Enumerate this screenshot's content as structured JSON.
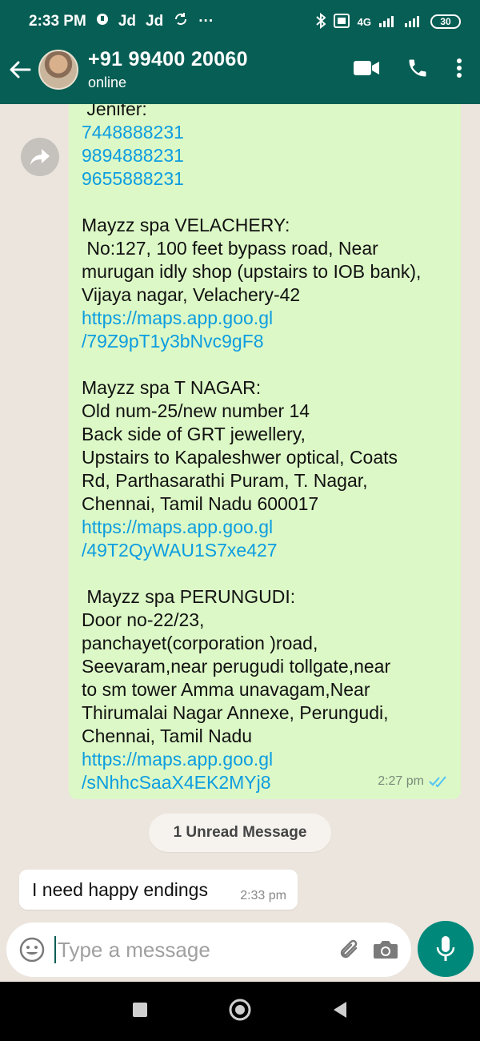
{
  "status_bar": {
    "time": "2:33 PM",
    "carrier_1": "Jd",
    "carrier_2": "Jd",
    "more": "···",
    "network": "4G",
    "battery": "30"
  },
  "header": {
    "contact_name": "+91 99400 20060",
    "contact_status": "online"
  },
  "chat": {
    "outgoing": {
      "lines": [
        {
          "text": " Jenifer:",
          "type": "text"
        },
        {
          "text": "7448888231",
          "type": "link"
        },
        {
          "text": "9894888231",
          "type": "link"
        },
        {
          "text": "9655888231",
          "type": "link"
        },
        {
          "text": "",
          "type": "gap"
        },
        {
          "text": "Mayzz spa VELACHERY:",
          "type": "text"
        },
        {
          "text": " No:127, 100 feet bypass road, Near",
          "type": "text"
        },
        {
          "text": "murugan idly shop (upstairs to IOB bank),",
          "type": "text"
        },
        {
          "text": "Vijaya nagar, Velachery-42",
          "type": "text"
        },
        {
          "text": "https://maps.app.goo.gl",
          "type": "link"
        },
        {
          "text": "/79Z9pT1y3bNvc9gF8",
          "type": "link"
        },
        {
          "text": "",
          "type": "gap"
        },
        {
          "text": "Mayzz spa T NAGAR:",
          "type": "text"
        },
        {
          "text": "Old num-25/new number 14",
          "type": "text"
        },
        {
          "text": "Back side of GRT jewellery,",
          "type": "text"
        },
        {
          "text": "Upstairs to Kapaleshwer optical, Coats",
          "type": "text"
        },
        {
          "text": "Rd, Parthasarathi Puram, T. Nagar,",
          "type": "text"
        },
        {
          "text": "Chennai, Tamil Nadu 600017",
          "type": "text"
        },
        {
          "text": "https://maps.app.goo.gl",
          "type": "link"
        },
        {
          "text": "/49T2QyWAU1S7xe427",
          "type": "link"
        },
        {
          "text": "",
          "type": "gap"
        },
        {
          "text": " Mayzz spa PERUNGUDI:",
          "type": "text"
        },
        {
          "text": "Door no-22/23,",
          "type": "text"
        },
        {
          "text": "panchayet(corporation )road,",
          "type": "text"
        },
        {
          "text": "Seevaram,near perugudi tollgate,near",
          "type": "text"
        },
        {
          "text": "to sm tower Amma unavagam,Near",
          "type": "text"
        },
        {
          "text": "Thirumalai Nagar Annexe, Perungudi,",
          "type": "text"
        },
        {
          "text": "Chennai, Tamil Nadu",
          "type": "text"
        },
        {
          "text": "https://maps.app.goo.gl",
          "type": "link"
        },
        {
          "text": "/sNhhcSaaX4EK2MYj8",
          "type": "link"
        }
      ],
      "time": "2:27 pm"
    },
    "unread_label": "1 Unread Message",
    "incoming": {
      "text": "I need happy endings",
      "time": "2:33 pm"
    }
  },
  "input": {
    "placeholder": "Type a message"
  },
  "colors": {
    "header_bg": "#075e54",
    "outgoing_bubble": "#dcf8c6",
    "link": "#0d9de0",
    "mic_button": "#00897b",
    "read_ticks": "#4fc3f7"
  }
}
